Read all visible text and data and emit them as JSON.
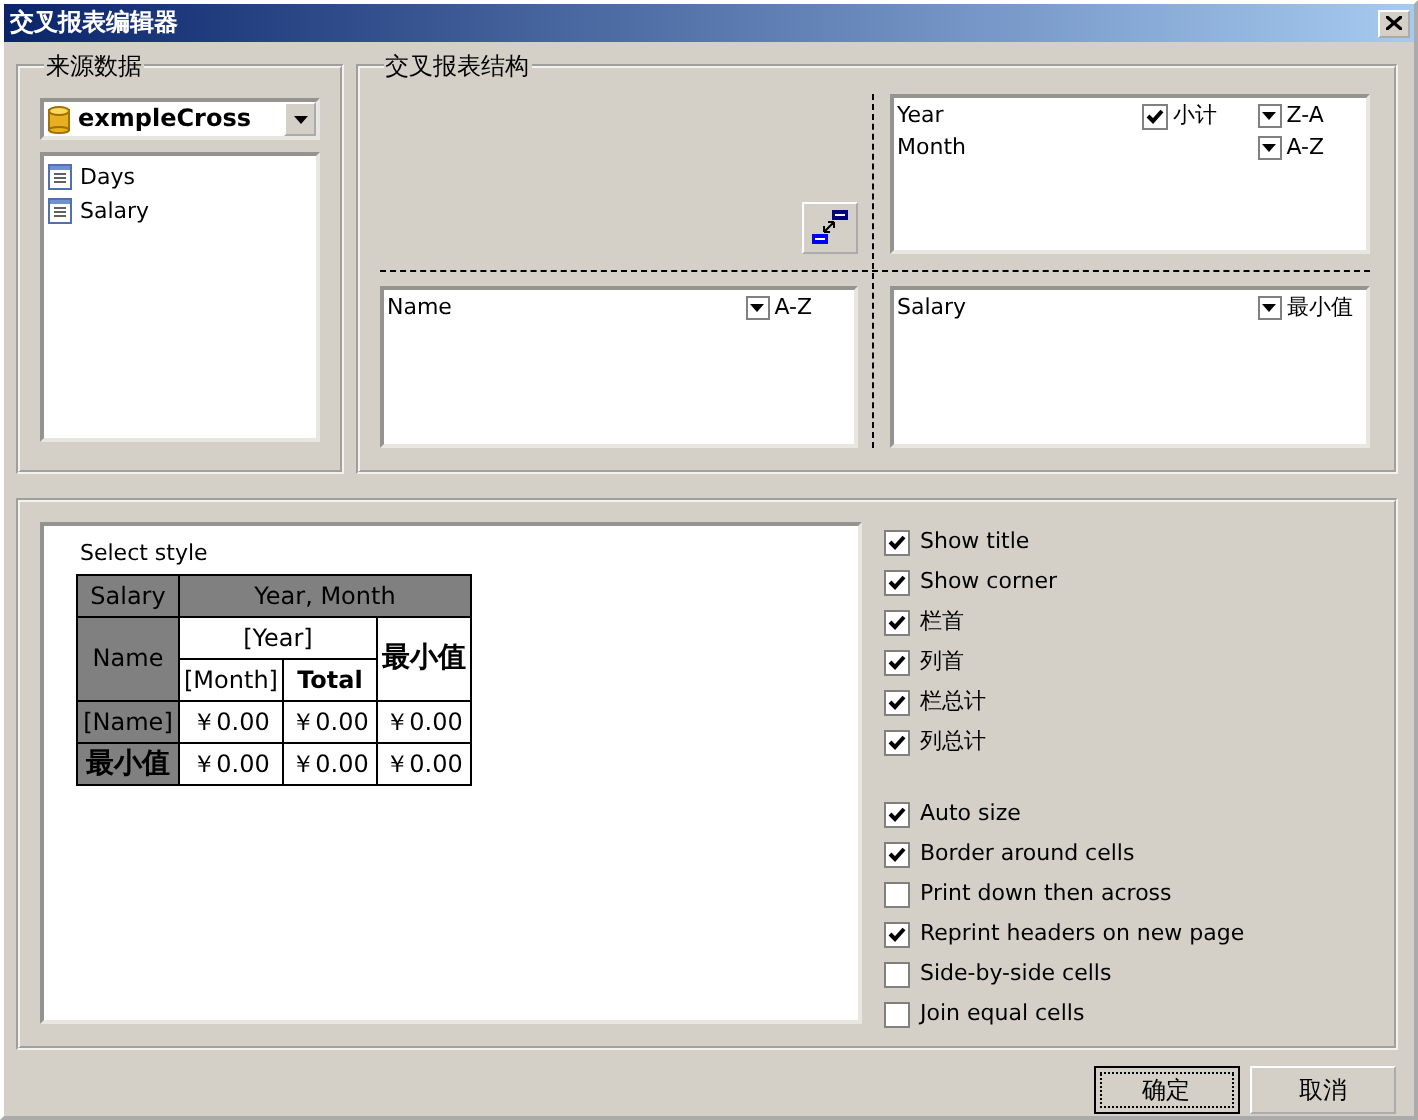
{
  "window": {
    "title": "交叉报表编辑器"
  },
  "source": {
    "label": "来源数据",
    "dataset": "exmpleCross",
    "tables": [
      "Days",
      "Salary"
    ]
  },
  "structure": {
    "label": "交叉报表结构",
    "columns": [
      {
        "field": "Year",
        "subtotal": {
          "label": "小计",
          "checked": true
        },
        "sort": "Z-A"
      },
      {
        "field": "Month",
        "sort": "A-Z"
      }
    ],
    "rows": [
      {
        "field": "Name",
        "sort": "A-Z"
      }
    ],
    "summaries": [
      {
        "field": "Salary",
        "sort": "最小值"
      }
    ]
  },
  "preview": {
    "label": "Select style",
    "corner": "Salary",
    "column_header": "Year, Month",
    "row_header": "Name",
    "column_field": "[Year]",
    "total_column": "最小值",
    "sub_field": "[Month]",
    "subtotal": "Total",
    "data_rows": [
      {
        "label": "[Name]",
        "values": [
          "￥0.00",
          "￥0.00",
          "￥0.00"
        ]
      },
      {
        "label": "最小值",
        "values": [
          "￥0.00",
          "￥0.00",
          "￥0.00"
        ]
      }
    ]
  },
  "option_groups": [
    [
      {
        "label": "Show title",
        "checked": true
      },
      {
        "label": "Show corner",
        "checked": true
      },
      {
        "label": "栏首",
        "checked": true
      },
      {
        "label": "列首",
        "checked": true
      },
      {
        "label": "栏总计",
        "checked": true
      },
      {
        "label": "列总计",
        "checked": true
      }
    ],
    [
      {
        "label": "Auto size",
        "checked": true
      },
      {
        "label": "Border around cells",
        "checked": true
      },
      {
        "label": "Print down then across",
        "checked": false
      },
      {
        "label": "Reprint headers on new page",
        "checked": true
      },
      {
        "label": "Side-by-side cells",
        "checked": false
      },
      {
        "label": "Join equal cells",
        "checked": false
      }
    ]
  ],
  "buttons": [
    {
      "label": "确定",
      "focused": true
    },
    {
      "label": "取消",
      "focused": false
    }
  ]
}
